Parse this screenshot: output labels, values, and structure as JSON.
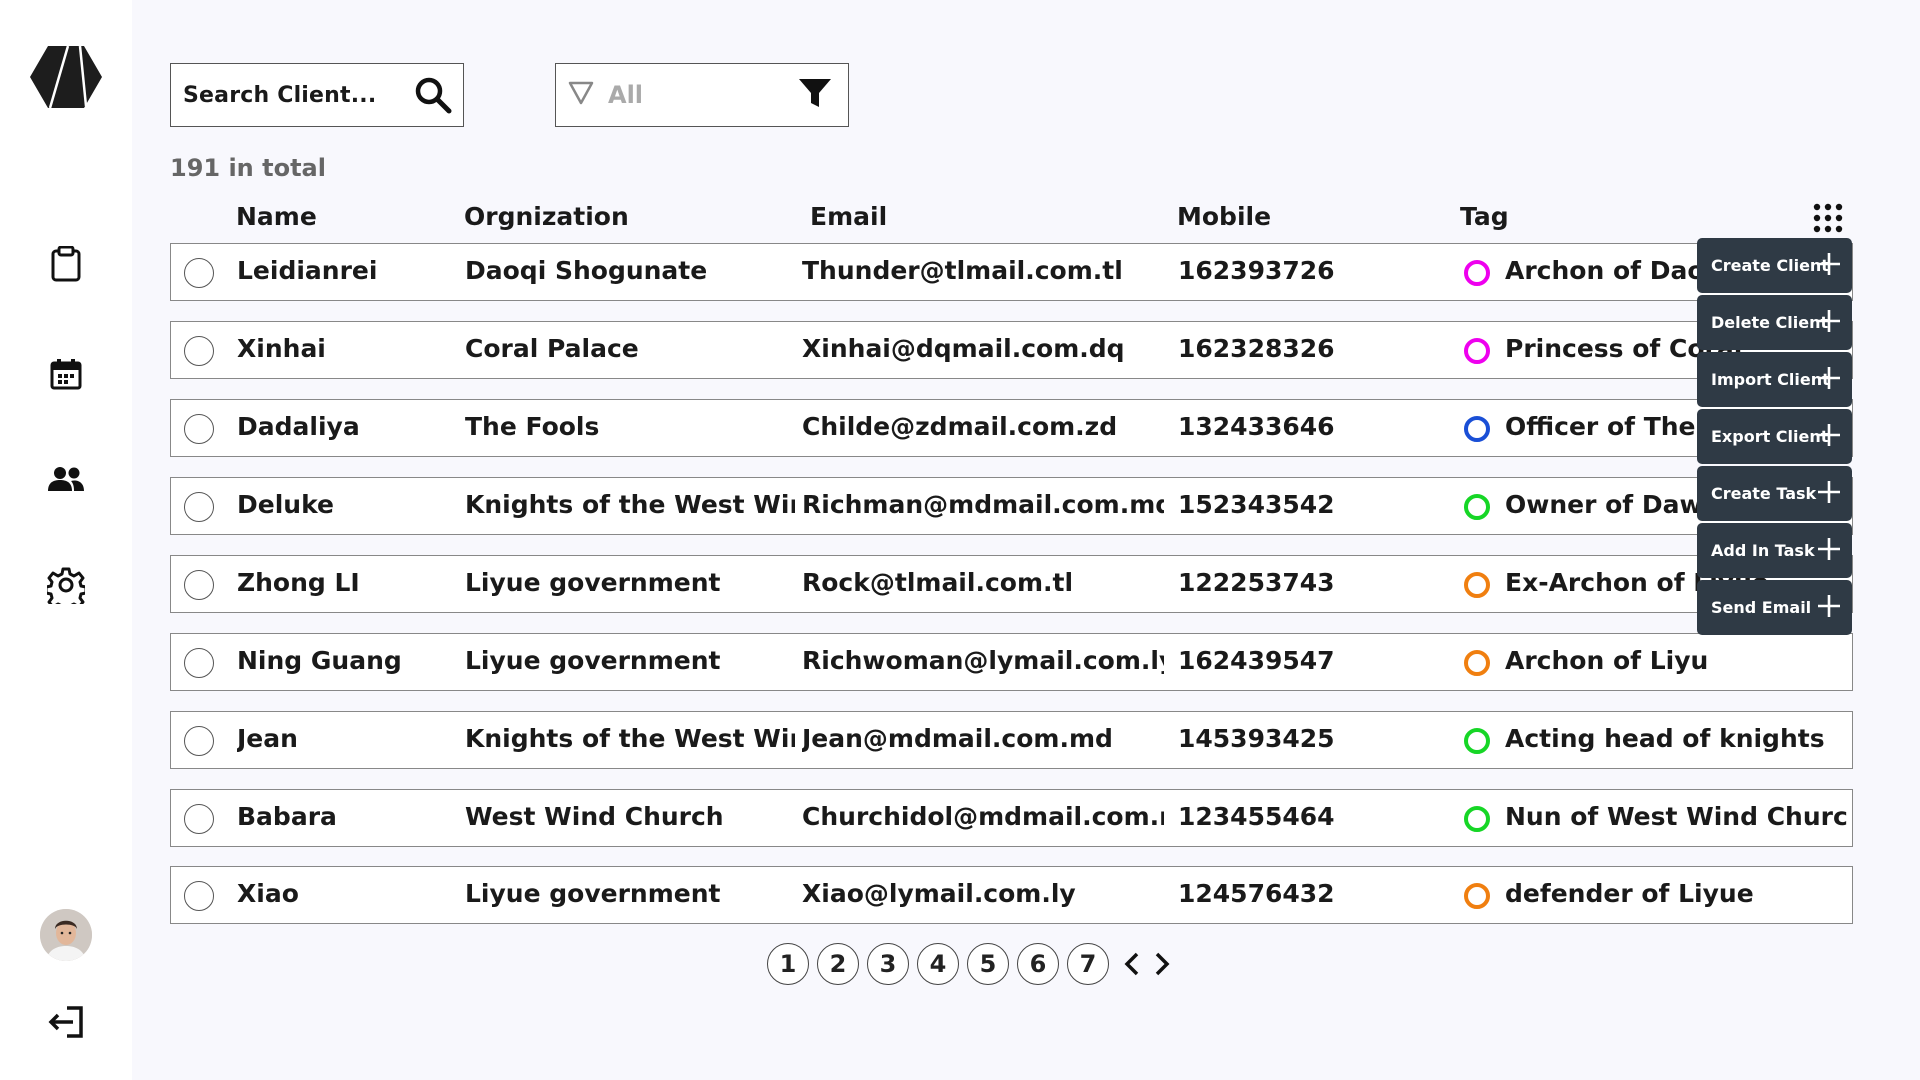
{
  "search": {
    "label": "Search Client..."
  },
  "filter": {
    "value": "All"
  },
  "total": "191 in total",
  "columns": {
    "name": "Name",
    "organization": "Orgnization",
    "email": "Email",
    "mobile": "Mobile",
    "tag": "Tag"
  },
  "rows": [
    {
      "name": "Leidianrei",
      "organization": "Daoqi Shogunate",
      "email": "Thunder@tlmail.com.tl",
      "mobile": "162393726",
      "tag": "Archon of Daoqi",
      "tag_color": "#ee00ee"
    },
    {
      "name": "Xinhai",
      "organization": "Coral Palace",
      "email": "Xinhai@dqmail.com.dq",
      "mobile": "162328326",
      "tag": "Princess of Coral",
      "tag_color": "#ee00ee"
    },
    {
      "name": "Dadaliya",
      "organization": "The Fools",
      "email": "Childe@zdmail.com.zd",
      "mobile": "132433646",
      "tag": "Officer of The Fools",
      "tag_color": "#1a4fd6"
    },
    {
      "name": "Deluke",
      "organization": "Knights of the West Wind",
      "email": "Richman@mdmail.com.md",
      "mobile": "152343542",
      "tag": "Owner of Dawn Winery",
      "tag_color": "#16d626"
    },
    {
      "name": "Zhong LI",
      "organization": "Liyue government",
      "email": "Rock@tlmail.com.tl",
      "mobile": "122253743",
      "tag": "Ex-Archon of Liyue",
      "tag_color": "#f07f10"
    },
    {
      "name": "Ning Guang",
      "organization": "Liyue government",
      "email": "Richwoman@lymail.com.ly",
      "mobile": "162439547",
      "tag": "Archon of Liyu",
      "tag_color": "#f07f10"
    },
    {
      "name": "Jean",
      "organization": "Knights of the West Wind",
      "email": "Jean@mdmail.com.md",
      "mobile": "145393425",
      "tag": "Acting head of knights",
      "tag_color": "#16d626"
    },
    {
      "name": "Babara",
      "organization": "West Wind Church",
      "email": "Churchidol@mdmail.com.md",
      "mobile": "123455464",
      "tag": "Nun of West Wind Church",
      "tag_color": "#16d626"
    },
    {
      "name": "Xiao",
      "organization": "Liyue government",
      "email": "Xiao@lymail.com.ly",
      "mobile": "124576432",
      "tag": "defender of Liyue",
      "tag_color": "#f07f10"
    }
  ],
  "menu": [
    "Create Client",
    "Delete Client",
    "Import Client",
    "Export Client",
    "Create Task",
    "Add In Task",
    "Send Email"
  ],
  "pagination": {
    "pages": [
      "1",
      "2",
      "3",
      "4",
      "5",
      "6",
      "7"
    ]
  },
  "icons": {
    "sidebar": [
      "logo-icon",
      "clipboard-icon",
      "calendar-icon",
      "people-icon",
      "gear-icon",
      "avatar",
      "logout-icon"
    ]
  }
}
